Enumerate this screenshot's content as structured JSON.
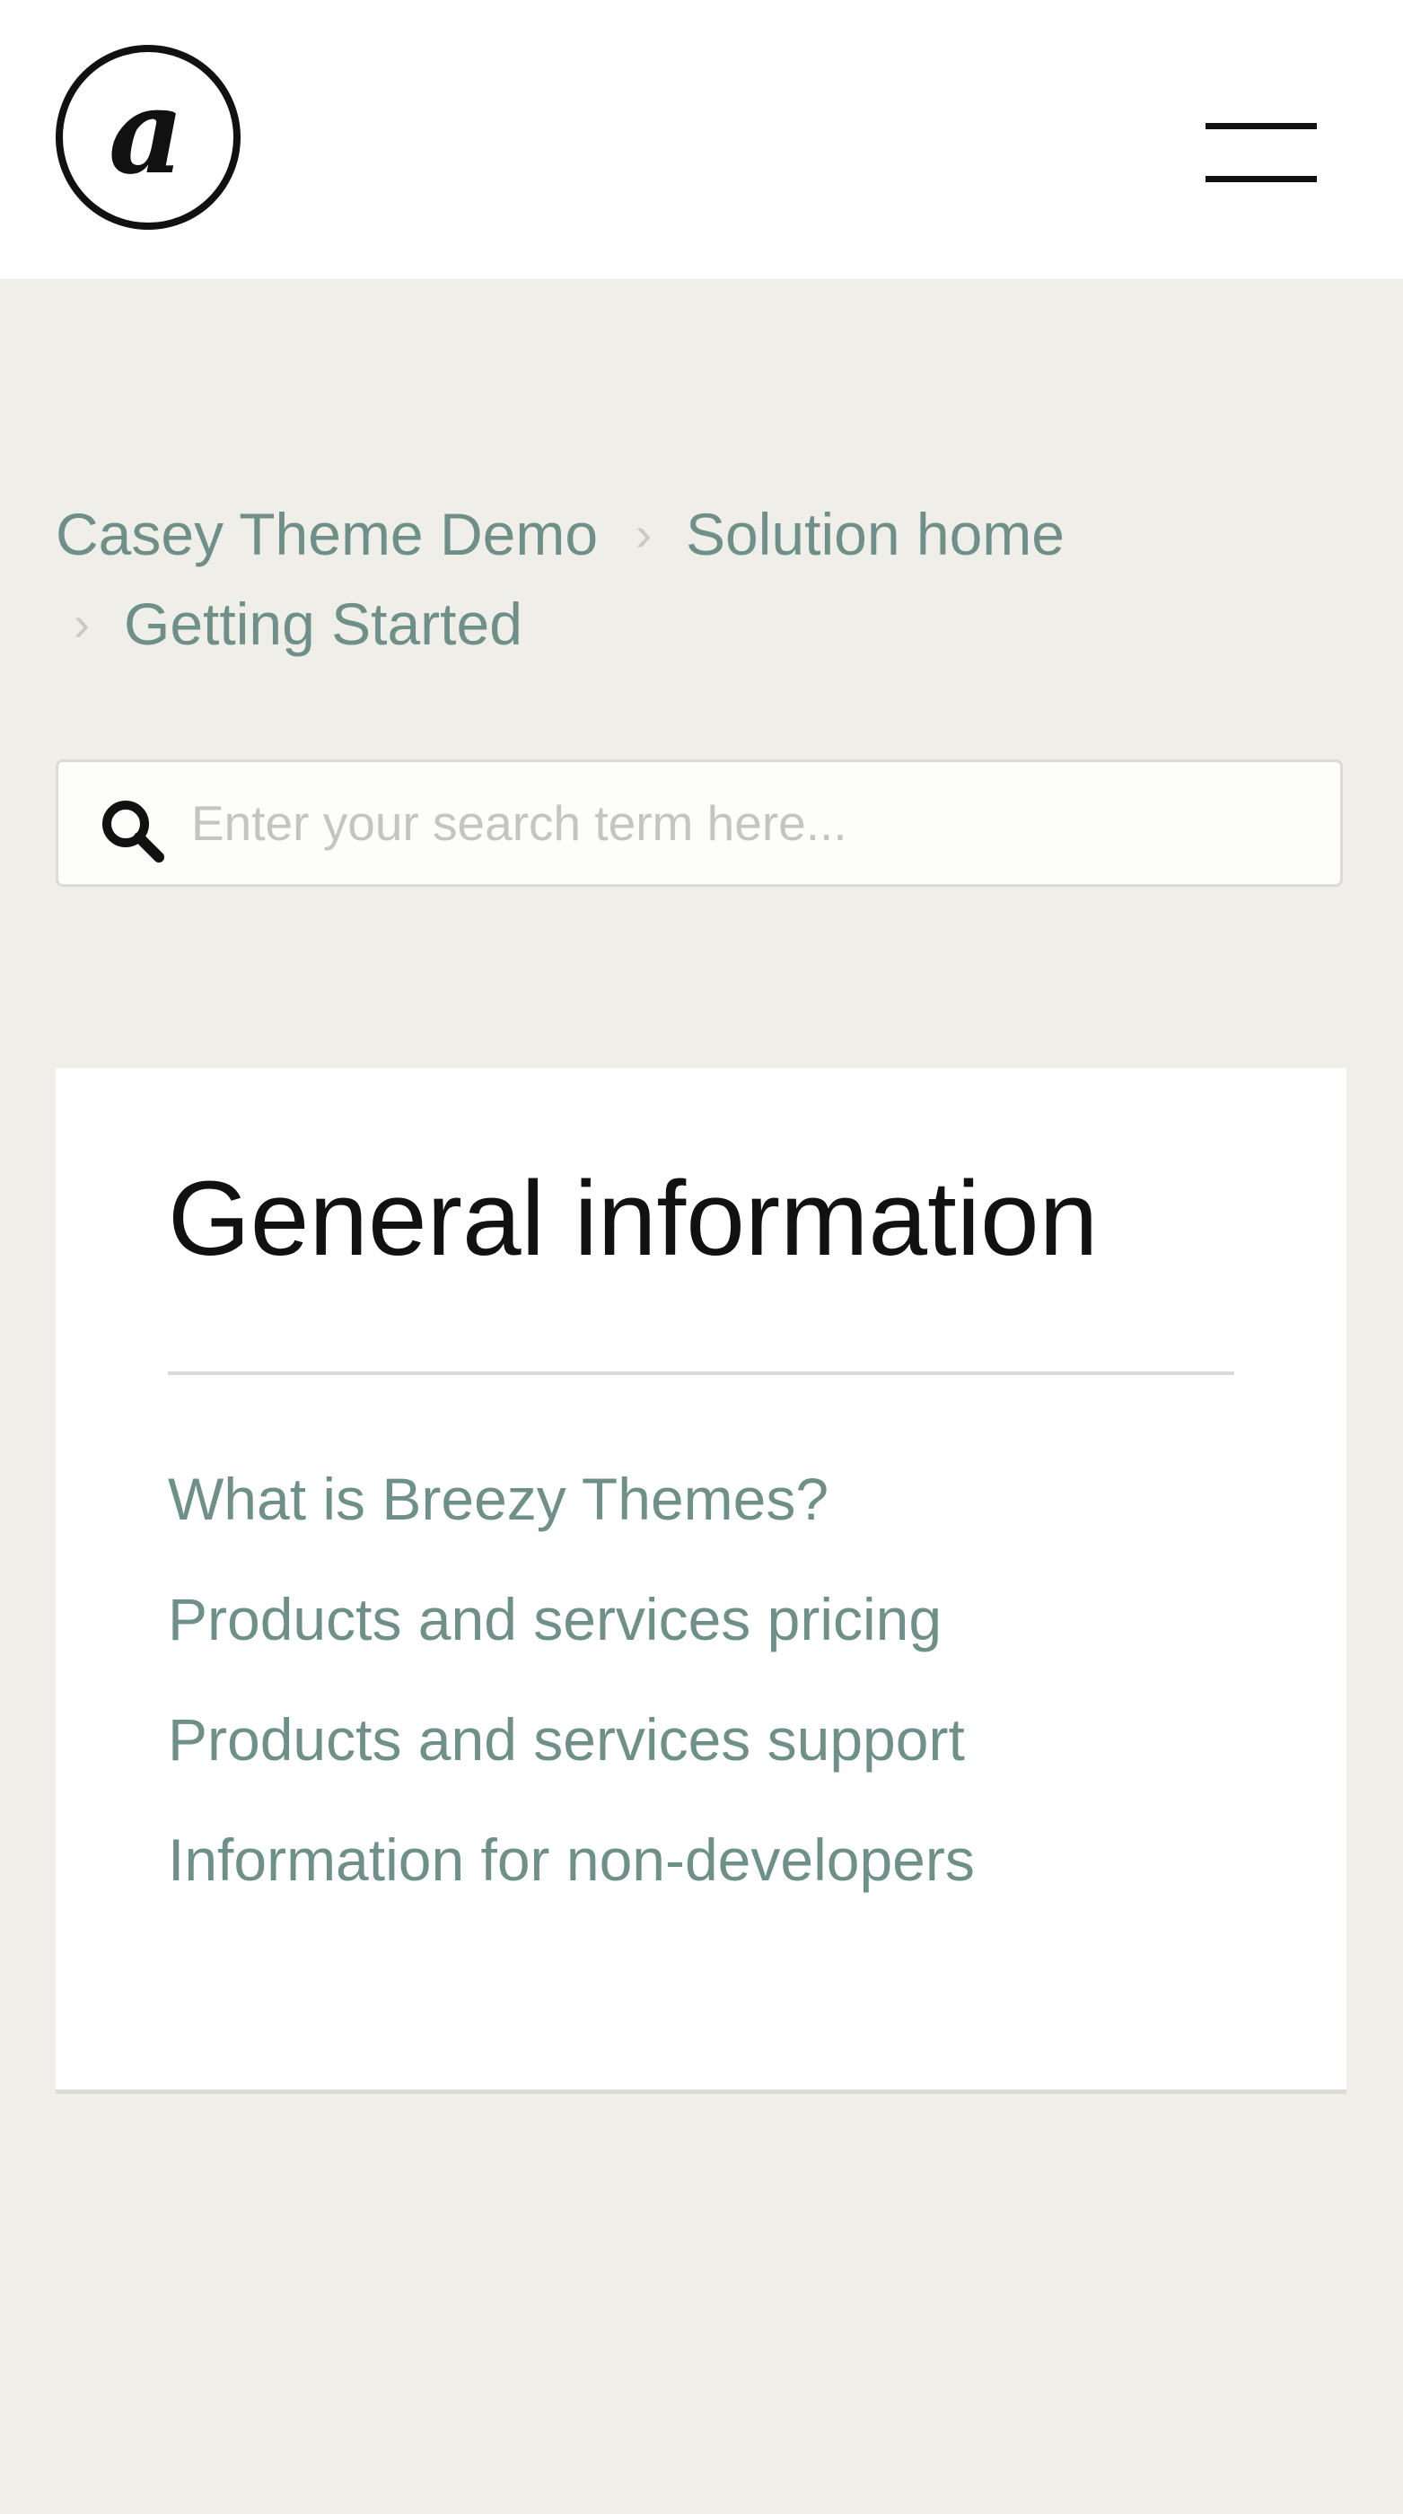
{
  "header": {
    "logo_icon": "at-sign-circle-logo",
    "menu_icon": "hamburger-menu-icon"
  },
  "breadcrumb": {
    "items": [
      "Casey Theme Demo",
      "Solution home",
      "Getting Started"
    ],
    "separator": "›"
  },
  "search": {
    "placeholder": "Enter your search term here...",
    "value": ""
  },
  "section": {
    "title": "General information",
    "articles": [
      "What is Breezy Themes?",
      "Products and services pricing",
      "Products and services support",
      "Information for non-developers"
    ]
  },
  "colors": {
    "page_background": "#f0eee9",
    "link": "#6f8f89",
    "title": "#111111"
  }
}
